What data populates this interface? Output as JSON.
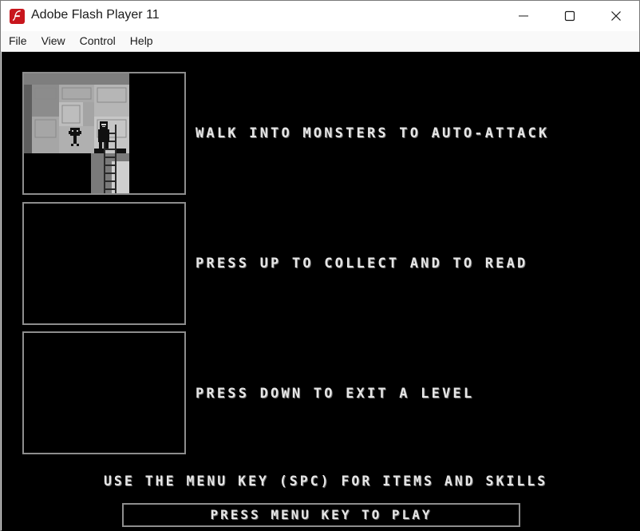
{
  "window": {
    "title": "Adobe Flash Player 11",
    "app_icon": "flash-player-icon",
    "controls": [
      "minimize-icon",
      "maximize-icon",
      "close-icon"
    ]
  },
  "menubar": {
    "items": [
      "File",
      "View",
      "Control",
      "Help"
    ]
  },
  "game": {
    "tips": [
      {
        "text": "WALK INTO MONSTERS TO AUTO-ATTACK",
        "preview": "dungeon-scene"
      },
      {
        "text": "PRESS UP TO COLLECT AND TO READ",
        "preview": "empty"
      },
      {
        "text": "PRESS DOWN TO EXIT A LEVEL",
        "preview": "empty"
      }
    ],
    "menu_hint": "USE THE MENU KEY (SPC) FOR ITEMS AND SKILLS",
    "play_button": "PRESS MENU KEY TO PLAY"
  }
}
